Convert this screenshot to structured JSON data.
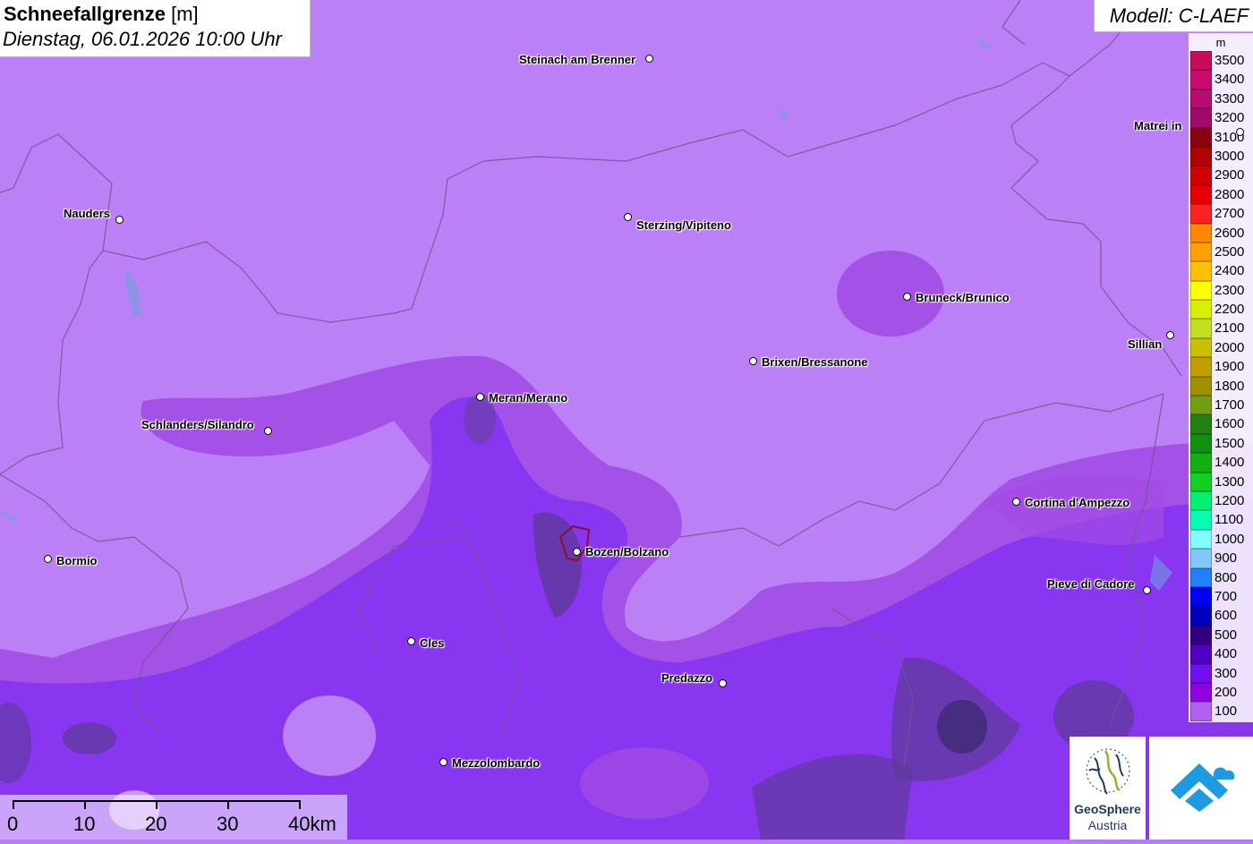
{
  "title": {
    "name": "Schneefallgrenze",
    "unit": "[m]",
    "datetime": "Dienstag, 06.01.2026 10:00 Uhr"
  },
  "model": {
    "label": "Modell: C-LAEF"
  },
  "legend": {
    "unit": "m",
    "entries": [
      {
        "value": "3500",
        "color": "#cc0a5a"
      },
      {
        "value": "3400",
        "color": "#c80b6a"
      },
      {
        "value": "3300",
        "color": "#b80c72"
      },
      {
        "value": "3200",
        "color": "#a00a6a"
      },
      {
        "value": "3100",
        "color": "#8a0010"
      },
      {
        "value": "3000",
        "color": "#b00000"
      },
      {
        "value": "2900",
        "color": "#d00000"
      },
      {
        "value": "2800",
        "color": "#e80000"
      },
      {
        "value": "2700",
        "color": "#ff2020"
      },
      {
        "value": "2600",
        "color": "#ff8800"
      },
      {
        "value": "2500",
        "color": "#ffa000"
      },
      {
        "value": "2400",
        "color": "#ffc000"
      },
      {
        "value": "2300",
        "color": "#ffff00"
      },
      {
        "value": "2200",
        "color": "#d8f000"
      },
      {
        "value": "2100",
        "color": "#c0e020"
      },
      {
        "value": "2000",
        "color": "#c8c000"
      },
      {
        "value": "1900",
        "color": "#c0a000"
      },
      {
        "value": "1800",
        "color": "#a09000"
      },
      {
        "value": "1700",
        "color": "#70a010"
      },
      {
        "value": "1600",
        "color": "#208010"
      },
      {
        "value": "1500",
        "color": "#109010"
      },
      {
        "value": "1400",
        "color": "#10b010"
      },
      {
        "value": "1300",
        "color": "#10d020"
      },
      {
        "value": "1200",
        "color": "#00f070"
      },
      {
        "value": "1100",
        "color": "#00ffb0"
      },
      {
        "value": "1000",
        "color": "#80ffff"
      },
      {
        "value": "900",
        "color": "#80c8ff"
      },
      {
        "value": "800",
        "color": "#2080ff"
      },
      {
        "value": "700",
        "color": "#0000ff"
      },
      {
        "value": "600",
        "color": "#0000c0"
      },
      {
        "value": "500",
        "color": "#300080"
      },
      {
        "value": "400",
        "color": "#5000c0"
      },
      {
        "value": "300",
        "color": "#7010f0"
      },
      {
        "value": "200",
        "color": "#9000e0"
      },
      {
        "value": "100",
        "color": "#b060f0"
      }
    ]
  },
  "places": [
    {
      "name": "Steinach am Brenner"
    },
    {
      "name": "Nauders"
    },
    {
      "name": "Sterzing/Vipiteno"
    },
    {
      "name": "Matrei in"
    },
    {
      "name": "Bruneck/Brunico"
    },
    {
      "name": "Sillian"
    },
    {
      "name": "Brixen/Bressanone"
    },
    {
      "name": "Meran/Merano"
    },
    {
      "name": "Schlanders/Silandro"
    },
    {
      "name": "Cortina d'Ampezzo"
    },
    {
      "name": "Bormio"
    },
    {
      "name": "Bozen/Bolzano"
    },
    {
      "name": "Pieve di Cadore"
    },
    {
      "name": "Cles"
    },
    {
      "name": "Predazzo"
    },
    {
      "name": "Mezzolombardo"
    }
  ],
  "scale": {
    "labels": [
      "0",
      "10",
      "20",
      "30",
      "40km"
    ]
  },
  "logos": {
    "geosphere_line1": "GeoSphere",
    "geosphere_line2": "Austria"
  }
}
